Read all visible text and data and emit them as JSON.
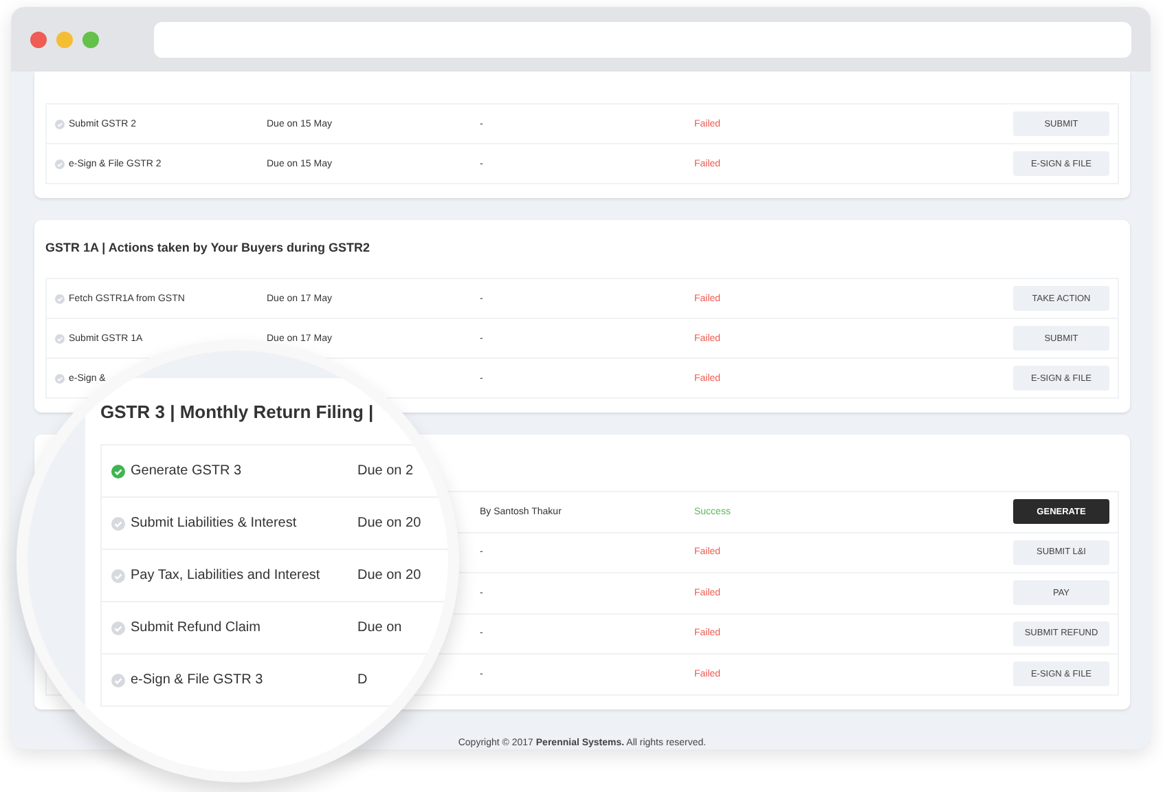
{
  "sections": [
    {
      "rows": [
        {
          "name": "Submit GSTR 2",
          "due": "Due on 15 May",
          "by": "-",
          "status": "Failed",
          "color": "#f05a50",
          "action": "SUBMIT",
          "primary": false
        },
        {
          "name": "e-Sign & File GSTR 2",
          "due": "Due on 15 May",
          "by": "-",
          "status": "Failed",
          "color": "#f05a50",
          "action": "E-SIGN & FILE",
          "primary": false
        }
      ]
    },
    {
      "title": "GSTR 1A | Actions taken by Your Buyers during GSTR2",
      "rows": [
        {
          "name": "Fetch GSTR1A from GSTN",
          "due": "Due on 17 May",
          "by": "-",
          "status": "Failed",
          "color": "#f05a50",
          "action": "TAKE ACTION",
          "primary": false
        },
        {
          "name": "Submit GSTR 1A",
          "due": "Due on 17 May",
          "by": "-",
          "status": "Failed",
          "color": "#f05a50",
          "action": "SUBMIT",
          "primary": false
        },
        {
          "name": "e-Sign &",
          "due": "",
          "by": "-",
          "status": "Failed",
          "color": "#f05a50",
          "action": "E-SIGN & FILE",
          "primary": false
        }
      ]
    },
    {
      "rows": [
        {
          "name": "",
          "due": "",
          "by": "By Santosh Thakur",
          "status": "Success",
          "color": "#5cb85c",
          "action": "GENERATE",
          "primary": true
        },
        {
          "name": "",
          "due": "",
          "by": "-",
          "status": "Failed",
          "color": "#f05a50",
          "action": "SUBMIT L&I",
          "primary": false
        },
        {
          "name": "",
          "due": "",
          "by": "-",
          "status": "Failed",
          "color": "#f05a50",
          "action": "PAY",
          "primary": false
        },
        {
          "name": "",
          "due": "",
          "by": "-",
          "status": "Failed",
          "color": "#f05a50",
          "action": "SUBMIT REFUND",
          "primary": false
        },
        {
          "name": "",
          "due": "",
          "by": "-",
          "status": "Failed",
          "color": "#f05a50",
          "action": "E-SIGN & FILE",
          "primary": false
        }
      ]
    }
  ],
  "magnifier": {
    "title": "GSTR 3 | Monthly Return Filing |",
    "rows": [
      {
        "name": "Generate GSTR 3",
        "due": "Due on 2",
        "done": true
      },
      {
        "name": "Submit Liabilities & Interest",
        "due": "Due on 20",
        "done": false
      },
      {
        "name": "Pay Tax, Liabilities and Interest",
        "due": "Due on 20",
        "done": false
      },
      {
        "name": "Submit Refund Claim",
        "due": "Due on",
        "done": false
      },
      {
        "name": "e-Sign & File GSTR 3",
        "due": "D",
        "done": false
      }
    ]
  },
  "footer": "Copyright © 2017 **Perennial Systems.** All rights reserved."
}
